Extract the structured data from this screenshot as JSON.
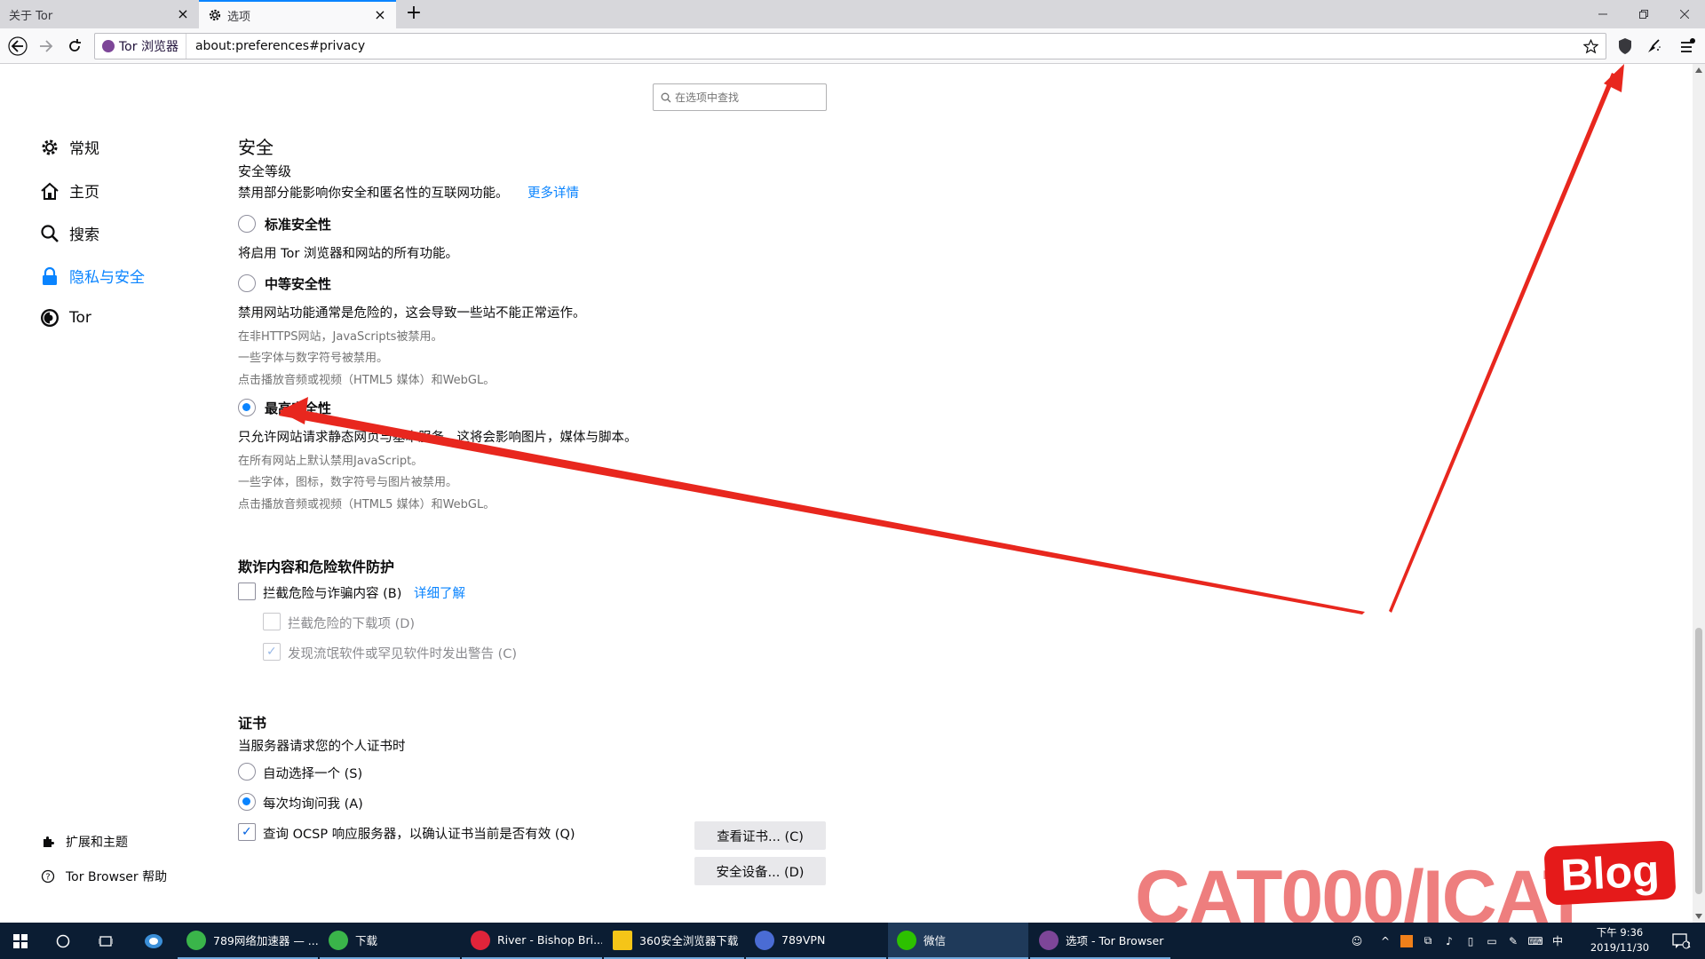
{
  "tabs": [
    {
      "title": "关于 Tor",
      "active": false
    },
    {
      "title": "选项",
      "active": true
    }
  ],
  "nav": {
    "identity_label": "Tor 浏览器",
    "url": "about:preferences#privacy"
  },
  "search": {
    "placeholder": "在选项中查找"
  },
  "sidebar": {
    "items": [
      {
        "label": "常规",
        "icon": "gear-icon"
      },
      {
        "label": "主页",
        "icon": "home-icon"
      },
      {
        "label": "搜索",
        "icon": "search-icon"
      },
      {
        "label": "隐私与安全",
        "icon": "lock-icon",
        "selected": true
      },
      {
        "label": "Tor",
        "icon": "tor-onion-icon"
      }
    ],
    "footer": [
      {
        "label": "扩展和主题",
        "icon": "puzzle-icon"
      },
      {
        "label": "Tor Browser 帮助",
        "icon": "help-icon"
      }
    ]
  },
  "security": {
    "section_title": "安全",
    "level_title": "安全等级",
    "level_desc": "禁用部分能影响你安全和匿名性的互联网功能。",
    "learn_more": "更多详情",
    "options": [
      {
        "label": "标准安全性",
        "checked": false,
        "desc": "将启用 Tor 浏览器和网站的所有功能。",
        "details": []
      },
      {
        "label": "中等安全性",
        "checked": false,
        "desc": "禁用网站功能通常是危险的，这会导致一些站不能正常运作。",
        "details": [
          "在非HTTPS网站，JavaScripts被禁用。",
          "一些字体与数字符号被禁用。",
          "点击播放音频或视频（HTML5 媒体）和WebGL。"
        ]
      },
      {
        "label": "最高安全性",
        "checked": true,
        "desc": "只允许网站请求静态网页与基本服务。这将会影响图片，媒体与脚本。",
        "details": [
          "在所有网站上默认禁用JavaScript。",
          "一些字体，图标，数字符号与图片被禁用。",
          "点击播放音频或视频（HTML5 媒体）和WebGL。"
        ]
      }
    ]
  },
  "phishing": {
    "title": "欺诈内容和危险软件防护",
    "block_dangerous": {
      "label": "拦截危险与诈骗内容 (B)",
      "checked": false
    },
    "learn_more": "详细了解",
    "block_downloads": {
      "label": "拦截危险的下载项 (D)",
      "checked": false,
      "disabled": true
    },
    "warn_unwanted": {
      "label": "发现流氓软件或罕见软件时发出警告 (C)",
      "checked": true,
      "disabled": true
    }
  },
  "certificates": {
    "title": "证书",
    "prompt": "当服务器请求您的个人证书时",
    "auto_select": {
      "label": "自动选择一个 (S)",
      "checked": false
    },
    "ask_every_time": {
      "label": "每次均询问我 (A)",
      "checked": true
    },
    "ocsp": {
      "label": "查询 OCSP 响应服务器，以确认证书当前是否有效 (Q)",
      "checked": true
    },
    "view_button": "查看证书... (C)",
    "devices_button": "安全设备... (D)"
  },
  "watermark": {
    "text": "CAT000/ICAT",
    "badge": "Blog",
    "color": "#e51a1a"
  },
  "taskbar": {
    "apps": [
      {
        "label": "789网络加速器 — ...",
        "color": "#3ab54a"
      },
      {
        "label": "下载",
        "color": "#3ab54a"
      },
      {
        "label": "River - Bishop Bri...",
        "color": "#e0243a"
      },
      {
        "label": "360安全浏览器下载",
        "color": "#f5c518"
      },
      {
        "label": "789VPN",
        "color": "#4a6cd4"
      },
      {
        "label": "微信",
        "color": "#2dc100"
      },
      {
        "label": "选项 - Tor Browser",
        "color": "#7d4698"
      }
    ],
    "ime": "中",
    "time": "下午 9:36",
    "date": "2019/11/30",
    "notification_count": "1"
  },
  "colors": {
    "accent": "#0a84ff",
    "arrow": "#e8271e"
  }
}
